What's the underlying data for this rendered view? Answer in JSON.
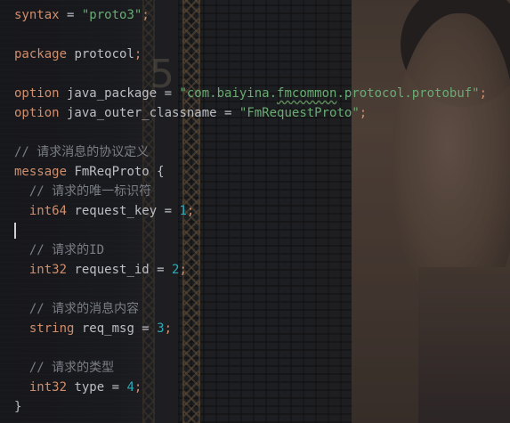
{
  "editor": {
    "language": "protobuf",
    "colors": {
      "keyword": "#cf8e6d",
      "string": "#6aab73",
      "number": "#2aacb8",
      "comment": "#7a7e85",
      "plain": "#bcbec4"
    },
    "lines": {
      "l1": {
        "kw": "syntax",
        "eq": " = ",
        "str": "\"proto3\"",
        "semi": ";"
      },
      "l3": {
        "kw": "package",
        "name": " protocol",
        "semi": ";"
      },
      "l5": {
        "kw": "option",
        "name": " java_package",
        "eq": " = ",
        "str_a": "\"com.baiyina.",
        "str_typo": "fmcommon",
        "str_b": ".protocol.protobuf\"",
        "semi": ";"
      },
      "l6": {
        "kw": "option",
        "name": " java_outer_classname",
        "eq": " = ",
        "str": "\"FmRequestProto\"",
        "semi": ";"
      },
      "l8": {
        "comment": "// 请求消息的协议定义"
      },
      "l9": {
        "kw": "message",
        "name": " FmReqProto {"
      },
      "l10": {
        "comment": "  // 请求的唯一标识符"
      },
      "l11": {
        "type": "  int64",
        "name": " request_key",
        "eq": " = ",
        "num": "1",
        "semi": ";"
      },
      "l13": {
        "comment": "  // 请求的ID"
      },
      "l14": {
        "type": "  int32",
        "name": " request_id",
        "eq": " = ",
        "num": "2",
        "semi": ";"
      },
      "l16": {
        "comment": "  // 请求的消息内容"
      },
      "l17": {
        "type": "  string",
        "name": " req_msg",
        "eq": " = ",
        "num": "3",
        "semi": ";"
      },
      "l19": {
        "comment": "  // 请求的类型"
      },
      "l20": {
        "type": "  int32",
        "name": " type",
        "eq": " = ",
        "num": "4",
        "semi": ";"
      },
      "l21": {
        "name": "}"
      }
    }
  },
  "background": {
    "digit": "5"
  }
}
